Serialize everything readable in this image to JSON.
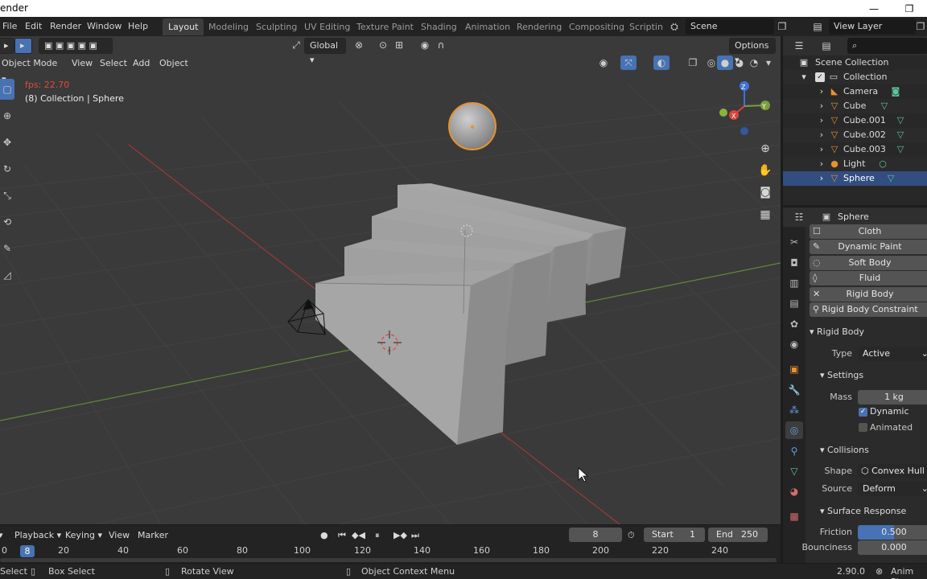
{
  "window": {
    "title": "ender",
    "minimize": "—",
    "maximize": "❐"
  },
  "menu": [
    "File",
    "Edit",
    "Render",
    "Window",
    "Help"
  ],
  "workspaces": [
    "Layout",
    "Modeling",
    "Sculpting",
    "UV Editing",
    "Texture Paint",
    "Shading",
    "Animation",
    "Rendering",
    "Compositing",
    "Scriptin"
  ],
  "scene": "Scene",
  "view_layer": "View Layer",
  "viewport": {
    "transform_orientation": "Global",
    "options_label": "Options",
    "mode": "Object Mode",
    "menus": [
      "View",
      "Select",
      "Add",
      "Object"
    ],
    "fps": "fps: 22.70",
    "object_info": "(8) Collection | Sphere",
    "axis_x": "X",
    "axis_y": "Y",
    "axis_z": "Z"
  },
  "outliner": {
    "root": "Scene Collection",
    "collection": "Collection",
    "items": [
      {
        "name": "Camera",
        "icon": "camera-icon"
      },
      {
        "name": "Cube",
        "icon": "mesh-icon"
      },
      {
        "name": "Cube.001",
        "icon": "mesh-icon"
      },
      {
        "name": "Cube.002",
        "icon": "mesh-icon"
      },
      {
        "name": "Cube.003",
        "icon": "mesh-icon"
      },
      {
        "name": "Light",
        "icon": "light-icon"
      },
      {
        "name": "Sphere",
        "icon": "mesh-icon",
        "selected": true
      }
    ]
  },
  "properties": {
    "object_name": "Sphere",
    "physics_buttons": [
      {
        "label": "Cloth",
        "icon": "cloth-icon"
      },
      {
        "label": "Dynamic Paint",
        "icon": "brush-icon"
      },
      {
        "label": "Soft Body",
        "icon": "softbody-icon"
      },
      {
        "label": "Fluid",
        "icon": "fluid-icon"
      },
      {
        "label": "Rigid Body",
        "icon": "remove-icon"
      },
      {
        "label": "Rigid Body Constraint",
        "icon": "constraint-icon"
      }
    ],
    "rigid_body": {
      "title": "Rigid Body",
      "type_label": "Type",
      "type_value": "Active",
      "settings_title": "Settings",
      "mass_label": "Mass",
      "mass_value": "1 kg",
      "dynamic_label": "Dynamic",
      "dynamic_checked": true,
      "animated_label": "Animated",
      "animated_checked": false,
      "collisions_title": "Collisions",
      "shape_label": "Shape",
      "shape_value": "Convex Hull",
      "source_label": "Source",
      "source_value": "Deform",
      "surface_title": "Surface Response",
      "friction_label": "Friction",
      "friction_value": "0.500",
      "friction_fraction": 0.5,
      "bounciness_label": "Bounciness",
      "bounciness_value": "0.000"
    }
  },
  "timeline": {
    "menus": [
      "Playback",
      "Keying",
      "View",
      "Marker"
    ],
    "current_frame": "8",
    "start_label": "Start",
    "start_value": "1",
    "end_label": "End",
    "end_value": "250",
    "ruler_ticks": [
      "0",
      "20",
      "40",
      "60",
      "80",
      "100",
      "120",
      "140",
      "160",
      "180",
      "200",
      "220",
      "240"
    ]
  },
  "statusbar": {
    "select": "Select",
    "box_select": "Box Select",
    "rotate_view": "Rotate View",
    "context_menu": "Object Context Menu",
    "version": "2.90.0",
    "anim_play": "Anim Play"
  }
}
